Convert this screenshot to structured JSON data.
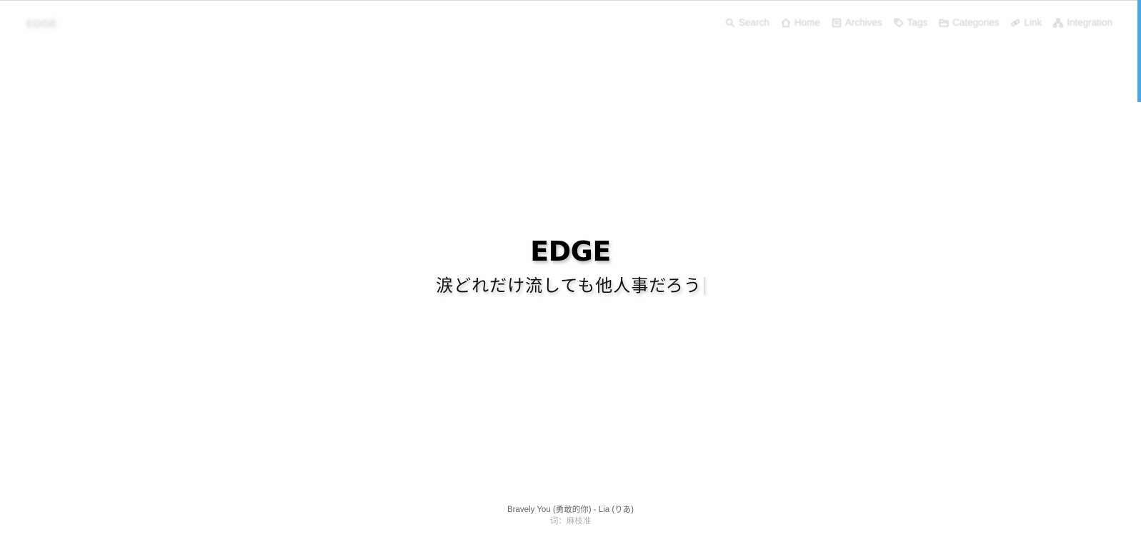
{
  "site": {
    "logo_text": "EDGE"
  },
  "nav": {
    "items": [
      {
        "label": "Search",
        "icon": "search-icon"
      },
      {
        "label": "Home",
        "icon": "home-icon"
      },
      {
        "label": "Archives",
        "icon": "archive-icon"
      },
      {
        "label": "Tags",
        "icon": "tags-icon"
      },
      {
        "label": "Categories",
        "icon": "folder-icon"
      },
      {
        "label": "Link",
        "icon": "link-icon"
      },
      {
        "label": "Integration",
        "icon": "sitemap-icon"
      }
    ]
  },
  "hero": {
    "title": "EDGE",
    "subtitle": "涙どれだけ流しても他人事だろう"
  },
  "lyric": {
    "song": "Bravely You (勇敢的你) - Lia (りあ)",
    "credit": "词：麻枝准"
  },
  "colors": {
    "accent": "#49a7e6",
    "nav_text": "#cfcfcf",
    "title": "#000000"
  }
}
